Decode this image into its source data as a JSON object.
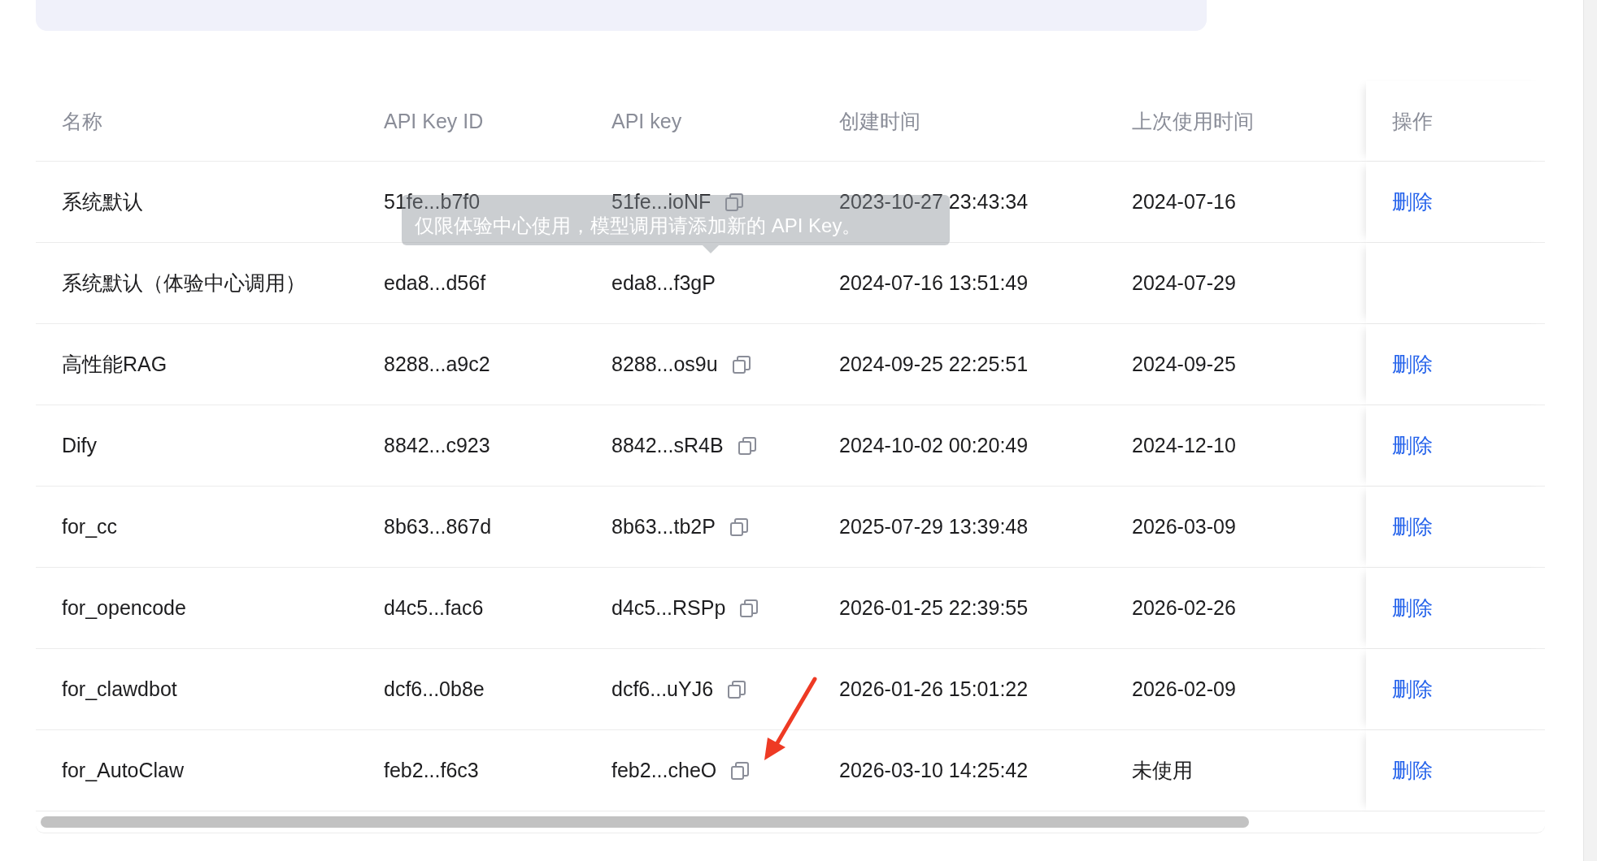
{
  "table": {
    "columns": [
      "名称",
      "API Key ID",
      "API key",
      "创建时间",
      "上次使用时间",
      "操作"
    ],
    "rows": [
      {
        "name": "系统默认",
        "key_id": "51fe...b7f0",
        "key": "51fe...ioNF",
        "copyable": true,
        "created": "2023-10-27 23:43:34",
        "last_used": "2024-07-16",
        "action": "删除"
      },
      {
        "name": "系统默认（体验中心调用）",
        "key_id": "eda8...d56f",
        "key": "eda8...f3gP",
        "copyable": false,
        "created": "2024-07-16 13:51:49",
        "last_used": "2024-07-29"
      },
      {
        "name": "高性能RAG",
        "key_id": "8288...a9c2",
        "key": "8288...os9u",
        "copyable": true,
        "created": "2024-09-25 22:25:51",
        "last_used": "2024-09-25",
        "action": "删除"
      },
      {
        "name": "Dify",
        "key_id": "8842...c923",
        "key": "8842...sR4B",
        "copyable": true,
        "created": "2024-10-02 00:20:49",
        "last_used": "2024-12-10",
        "action": "删除"
      },
      {
        "name": "for_cc",
        "key_id": "8b63...867d",
        "key": "8b63...tb2P",
        "copyable": true,
        "created": "2025-07-29 13:39:48",
        "last_used": "2026-03-09",
        "action": "删除"
      },
      {
        "name": "for_opencode",
        "key_id": "d4c5...fac6",
        "key": "d4c5...RSPp",
        "copyable": true,
        "created": "2026-01-25 22:39:55",
        "last_used": "2026-02-26",
        "action": "删除"
      },
      {
        "name": "for_clawdbot",
        "key_id": "dcf6...0b8e",
        "key": "dcf6...uYJ6",
        "copyable": true,
        "created": "2026-01-26 15:01:22",
        "last_used": "2026-02-09",
        "action": "删除"
      },
      {
        "name": "for_AutoClaw",
        "key_id": "feb2...f6c3",
        "key": "feb2...cheO",
        "copyable": true,
        "created": "2026-03-10 14:25:42",
        "last_used": "未使用",
        "action": "删除"
      }
    ],
    "tooltip": "仅限体验中心使用，模型调用请添加新的 API Key。"
  }
}
